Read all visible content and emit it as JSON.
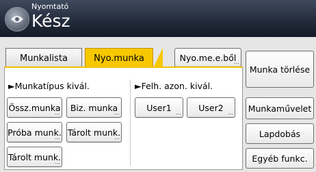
{
  "header": {
    "subtitle": "Nyomtató",
    "status": "Kész"
  },
  "tabs": [
    {
      "label": "Munkalista",
      "active": false
    },
    {
      "label": "Nyo.munka",
      "active": true
    }
  ],
  "top_button": {
    "label": "Nyo.me.e.ből"
  },
  "sections": {
    "job_type": "►Munkatípus kivál.",
    "user_id": "►Felh. azon. kivál."
  },
  "job_buttons": {
    "all": "Össz.munka",
    "locked": "Biz. munka",
    "sample": "Próba munk.",
    "hold": "Tárolt munk.",
    "stored": "Tárolt munk."
  },
  "user_buttons": {
    "user1": "User1",
    "user2": "User2"
  },
  "side_buttons": {
    "delete": "Munka törlése",
    "operations": "Munkaművelet",
    "scroll": "Lapdobás",
    "other": "Egyéb funkc."
  },
  "colors": {
    "header_bg": "#1f2737",
    "active_tab": "#f7c800"
  },
  "icons": {
    "logo": "printer-logo-icon",
    "more": "ellipsis-icon"
  }
}
